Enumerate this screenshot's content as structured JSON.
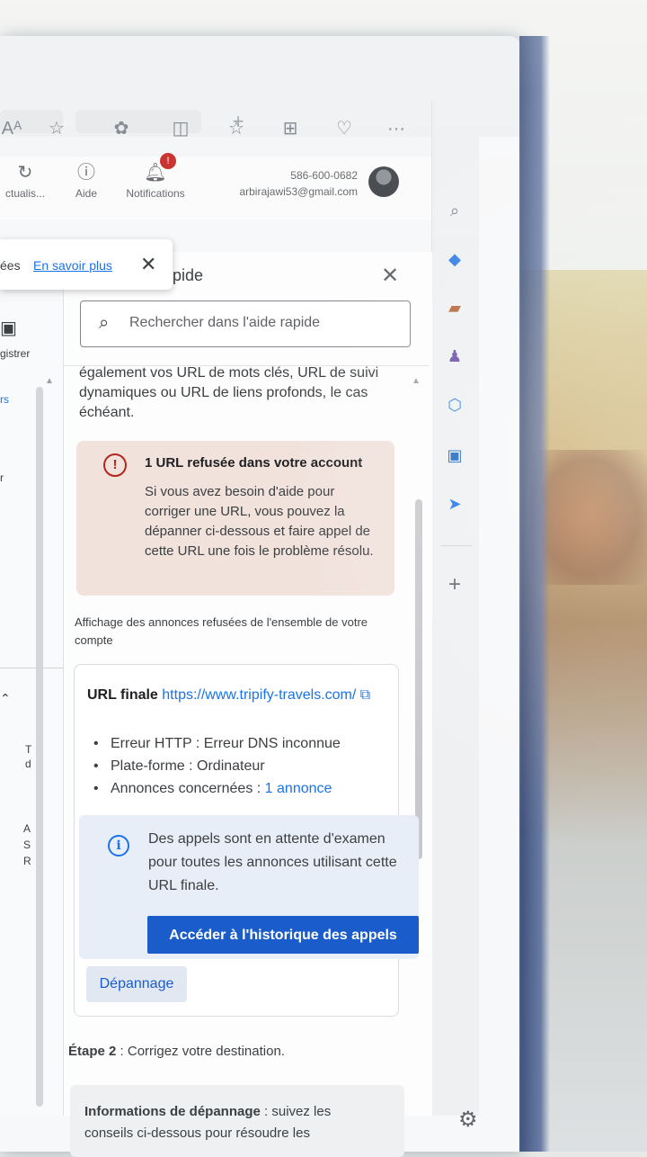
{
  "header": {
    "actualiser_label": "ctualis...",
    "aide_label": "Aide",
    "notifications_label": "Notifications",
    "notifications_count": "!",
    "phone": "586-600-0682",
    "email": "arbirajawi53@gmail.com"
  },
  "toast": {
    "text": "ées",
    "link": "En savoir plus",
    "close": "✕"
  },
  "left_fragment": {
    "save_label": "gistrer",
    "rs_label": "rs",
    "r_label": "r",
    "t_label": "T",
    "d_label": "d",
    "a_label": "A",
    "s_label": "S",
    "R_label": "R"
  },
  "panel": {
    "title": "pide",
    "search_placeholder": "Rechercher dans l'aide rapide",
    "intro_text": "également vos URL de mots clés, URL de suivi dynamiques ou URL de liens profonds, le cas échéant.",
    "alert": {
      "title": "1 URL refusée dans votre account",
      "body": "Si vous avez besoin d'aide pour corriger une URL, vous pouvez la dépanner ci-dessous et faire appel de cette URL une fois le problème résolu."
    },
    "caption": "Affichage des annonces refusées de l'ensemble de votre compte",
    "url_card": {
      "label": "URL finale",
      "url": "https://www.tripify-travels.com/",
      "bullets": [
        {
          "text": "Erreur HTTP : Erreur DNS inconnue",
          "link": ""
        },
        {
          "text": "Plate-forme : Ordinateur",
          "link": ""
        },
        {
          "text": "Annonces concernées : ",
          "link": "1 annonce"
        }
      ]
    },
    "info": {
      "text": "Des appels sont en attente d'examen pour toutes les annonces utilisant cette URL finale.",
      "button": "Accéder à l'historique des appels"
    },
    "trouble_button": "Dépannage",
    "step2_prefix": "Étape 2",
    "step2_text": " : Corrigez votre destination.",
    "troubleshoot_info_label": "Informations de dépannage",
    "troubleshoot_info_text": " : suivez les conseils ci-dessous pour résoudre les"
  },
  "colors": {
    "accent": "#1a73e8",
    "button": "#1a5cc9",
    "alert_bg": "#f1e2dc",
    "error": "#b3261e"
  }
}
